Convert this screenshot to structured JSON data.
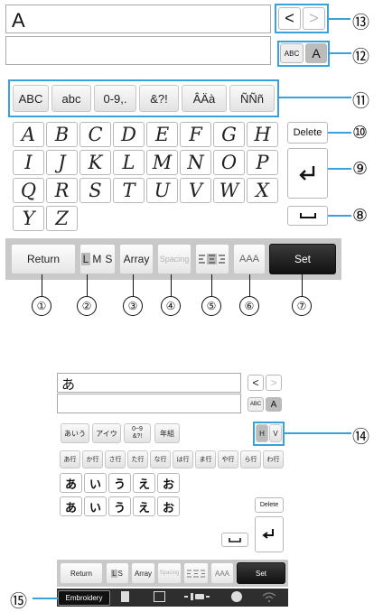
{
  "top": {
    "input_text": "A",
    "cursor_buttons": [
      "<",
      ">"
    ],
    "case_buttons": [
      "ABC",
      "A"
    ],
    "char_tabs": [
      "ABC",
      "abc",
      "0-9,.",
      "&?!",
      "ÂÄà",
      "ÑÑñ"
    ],
    "script_keys": [
      "A",
      "B",
      "C",
      "D",
      "E",
      "F",
      "G",
      "H",
      "I",
      "J",
      "K",
      "L",
      "M",
      "N",
      "O",
      "P",
      "Q",
      "R",
      "S",
      "T",
      "U",
      "V",
      "W",
      "X",
      "Y",
      "Z"
    ],
    "delete_label": "Delete",
    "enter_icon": "return-arrow-icon",
    "space_icon": "space-bar-icon",
    "toolbar": {
      "return_label": "Return",
      "size_labels": [
        "L",
        "M",
        "S"
      ],
      "array_label": "Array",
      "spacing_label": "Spacing",
      "align_icon": "align-icon",
      "font_size_label": "AAA",
      "set_label": "Set"
    },
    "callouts": [
      "⑬",
      "⑫",
      "⑪",
      "⑩",
      "⑨",
      "⑧"
    ],
    "bottom_numbers": [
      "①",
      "②",
      "③",
      "④",
      "⑤",
      "⑥",
      "⑦"
    ]
  },
  "bottom": {
    "input_text": "あ",
    "cursor_buttons": [
      "<",
      ">"
    ],
    "case_buttons": [
      "ABC",
      "A"
    ],
    "char_tabs": [
      "あいう",
      "アイウ",
      "0~9\n&?!",
      "年組"
    ],
    "hv_labels": [
      "H",
      "V"
    ],
    "row_tabs": [
      "あ行",
      "か行",
      "さ行",
      "た行",
      "な行",
      "は行",
      "ま行",
      "や行",
      "ら行",
      "わ行"
    ],
    "kana_row1": [
      "あ",
      "い",
      "う",
      "え",
      "お"
    ],
    "kana_row2": [
      "あ",
      "い",
      "う",
      "え",
      "お"
    ],
    "delete_label": "Delete",
    "toolbar": {
      "return_label": "Return",
      "size_labels": [
        "L",
        "S"
      ],
      "array_label": "Array",
      "spacing_label": "Spacing",
      "font_size_label": "AAA",
      "set_label": "Set"
    },
    "status_bar": {
      "embroidery_label": "Embroidery"
    },
    "callouts": [
      "⑭",
      "⑮"
    ]
  }
}
